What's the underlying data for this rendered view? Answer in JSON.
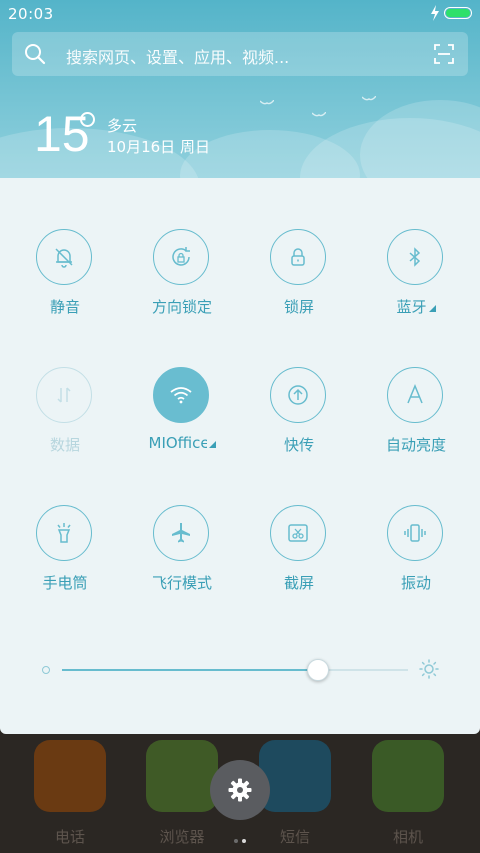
{
  "status_bar": {
    "time": "20:03",
    "battery_level": 1.0
  },
  "search": {
    "placeholder": "搜索网页、设置、应用、视频..."
  },
  "weather": {
    "temperature": "15",
    "condition": "多云",
    "date": "10月16日 周日"
  },
  "tiles": [
    {
      "id": "mute",
      "label": "静音",
      "icon": "bell-off-icon",
      "state": "off",
      "has_menu": false
    },
    {
      "id": "rotation-lock",
      "label": "方向锁定",
      "icon": "rotation-lock-icon",
      "state": "off",
      "has_menu": false
    },
    {
      "id": "lock-screen",
      "label": "锁屏",
      "icon": "lock-icon",
      "state": "off",
      "has_menu": false
    },
    {
      "id": "bluetooth",
      "label": "蓝牙",
      "icon": "bluetooth-icon",
      "state": "off",
      "has_menu": true
    },
    {
      "id": "data",
      "label": "数据",
      "icon": "data-arrows-icon",
      "state": "disabled",
      "has_menu": false
    },
    {
      "id": "wifi",
      "label": "MIOffice",
      "icon": "wifi-icon",
      "state": "on",
      "has_menu": true
    },
    {
      "id": "quick-transfer",
      "label": "快传",
      "icon": "upload-icon",
      "state": "off",
      "has_menu": false
    },
    {
      "id": "auto-brightness",
      "label": "自动亮度",
      "icon": "auto-a-icon",
      "state": "off",
      "has_menu": false
    },
    {
      "id": "flashlight",
      "label": "手电筒",
      "icon": "flashlight-icon",
      "state": "off",
      "has_menu": false
    },
    {
      "id": "airplane",
      "label": "飞行模式",
      "icon": "airplane-icon",
      "state": "off",
      "has_menu": false
    },
    {
      "id": "screenshot",
      "label": "截屏",
      "icon": "scissors-icon",
      "state": "off",
      "has_menu": false
    },
    {
      "id": "vibrate",
      "label": "振动",
      "icon": "vibrate-icon",
      "state": "off",
      "has_menu": false
    }
  ],
  "brightness": {
    "level": 0.74
  },
  "dock": {
    "apps": [
      {
        "name": "电话",
        "icon": "phone-app-icon",
        "color": "#6a3a12"
      },
      {
        "name": "浏览器",
        "icon": "browser-app-icon",
        "color": "#3f5a26"
      },
      {
        "name": "短信",
        "icon": "messages-app-icon",
        "color": "#1e4a5e"
      },
      {
        "name": "相机",
        "icon": "camera-app-icon",
        "color": "#3a5a26"
      }
    ],
    "page_count": 2,
    "current_page": 1
  },
  "colors": {
    "accent": "#67bcce",
    "label": "#3a9fb6",
    "panel_bg": "#ecf4f6",
    "header_top": "#54b4c9"
  }
}
